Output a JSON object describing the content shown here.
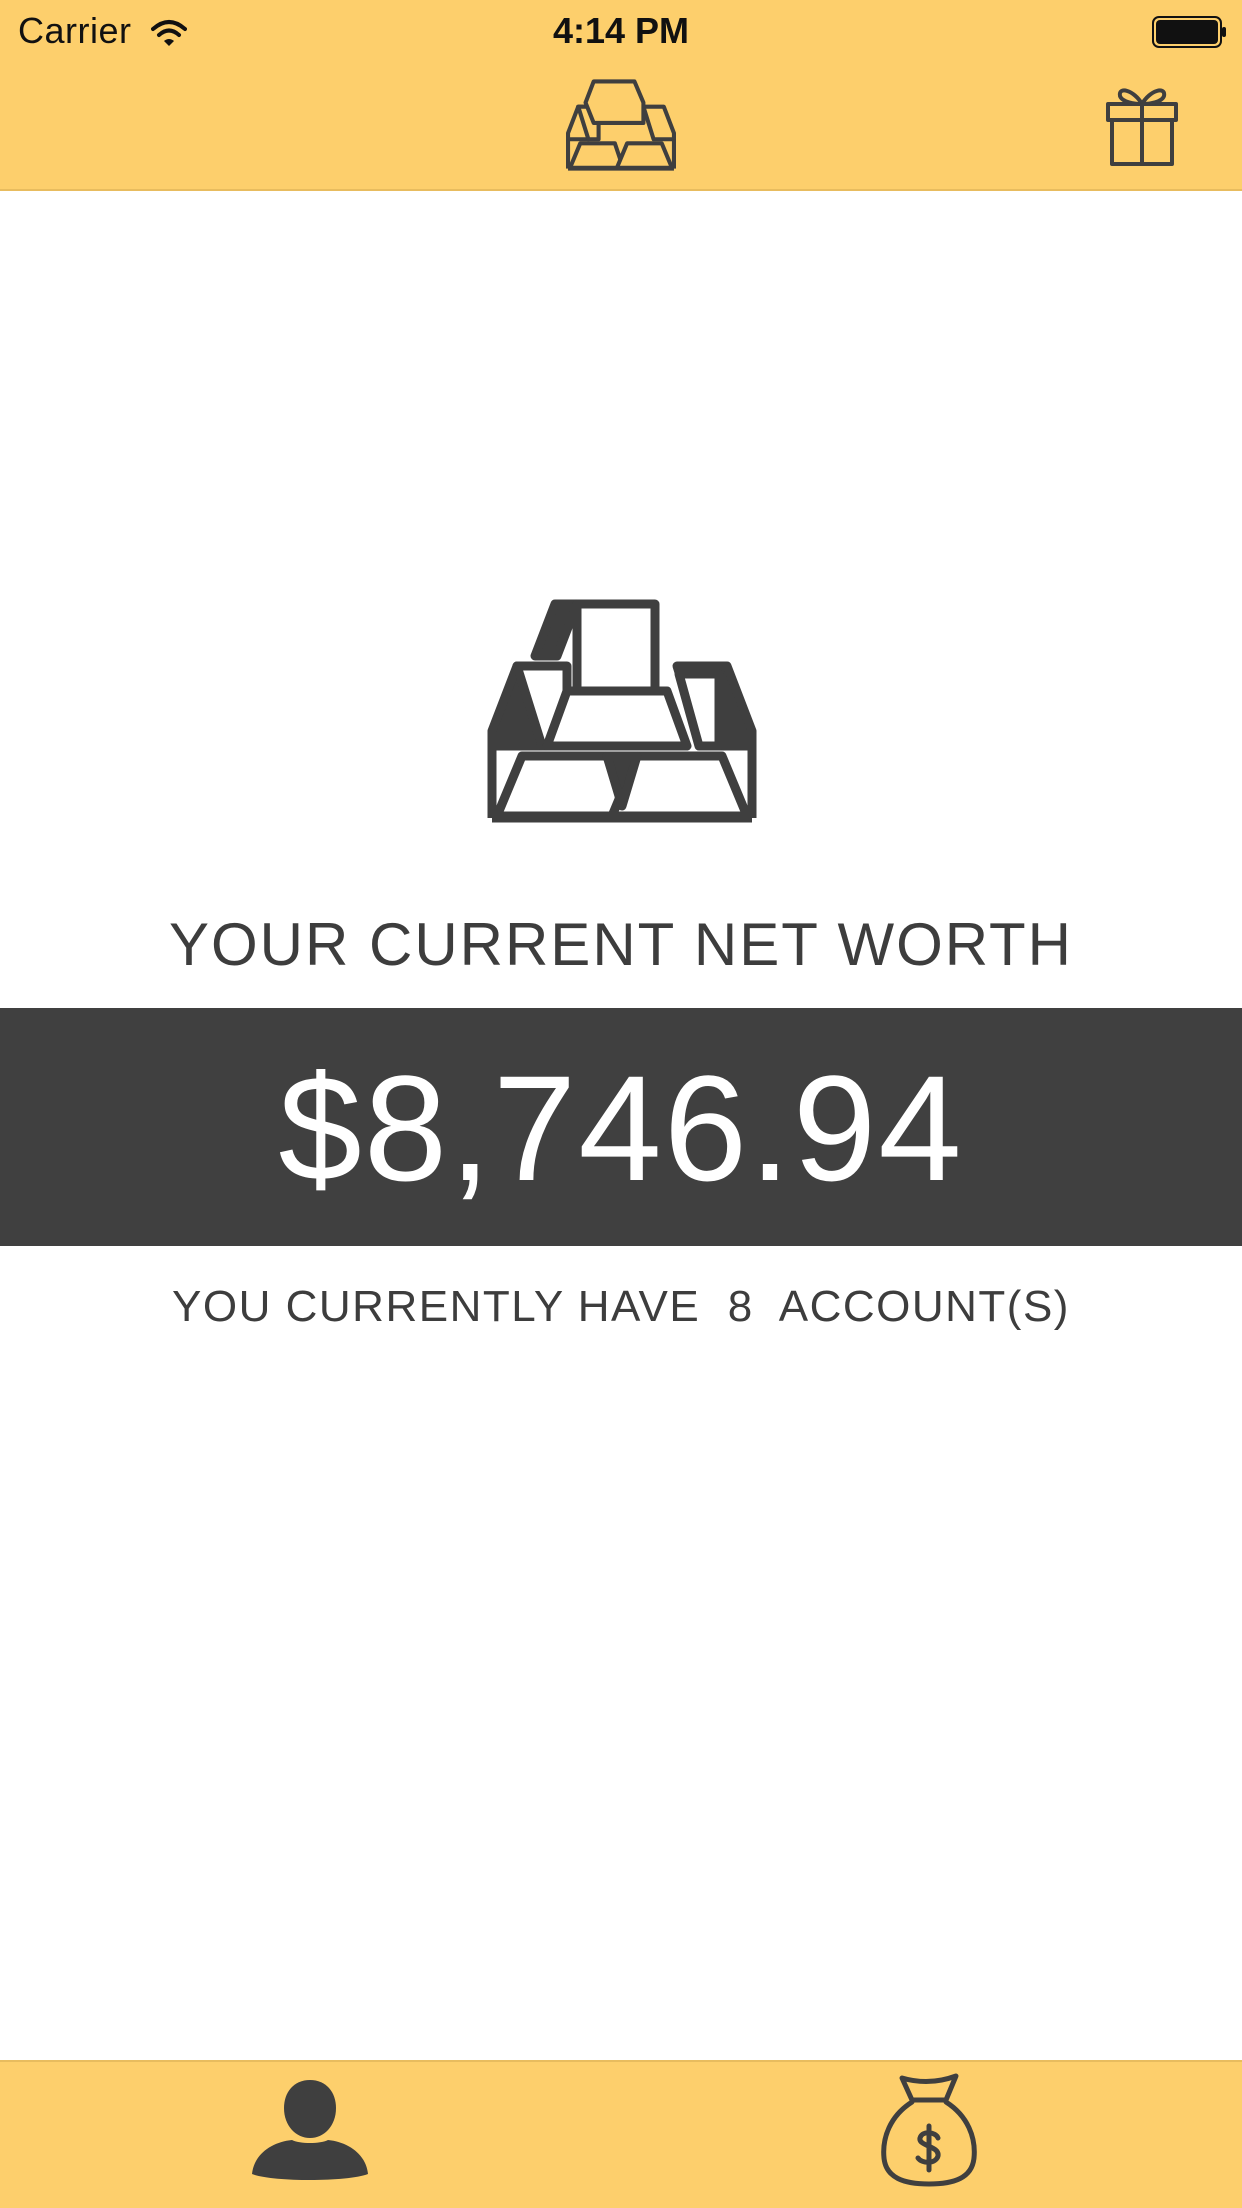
{
  "status_bar": {
    "carrier": "Carrier",
    "time": "4:14 PM",
    "icons": [
      "wifi-icon",
      "battery-icon"
    ]
  },
  "nav": {
    "logo_icon": "gold-bars-icon",
    "right_button_icon": "gift-icon"
  },
  "summary": {
    "hero_icon": "gold-bars-icon",
    "label": "YOUR CURRENT NET WORTH",
    "net_worth": "$8,746.94",
    "accounts_prefix": "YOU CURRENTLY HAVE",
    "accounts_count": "8",
    "accounts_suffix": "ACCOUNT(S)"
  },
  "tab_bar": {
    "tabs": [
      {
        "icon": "person-icon"
      },
      {
        "icon": "money-bag-icon"
      }
    ]
  },
  "colors": {
    "accent": "#fdcf6c",
    "dark": "#404040",
    "background": "#ffffff"
  }
}
